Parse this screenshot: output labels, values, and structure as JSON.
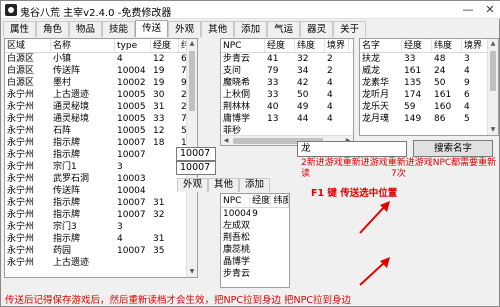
{
  "window": {
    "title": "鬼谷八荒 主宰v2.4.0 -免费修改器",
    "minimize": "—",
    "close": "✕"
  },
  "tabs": [
    "属性",
    "角色",
    "物品",
    "技能",
    "传送",
    "外观",
    "其他",
    "添加",
    "气运",
    "器灵",
    "关于"
  ],
  "active_tab": "传送",
  "left_list": {
    "columns": [
      "区域",
      "名称",
      "type",
      "经度",
      "纬度"
    ],
    "rows": [
      [
        "白源区",
        "小镇",
        "4",
        "12",
        "6"
      ],
      [
        "白源区",
        "传送阵",
        "10004",
        "19",
        "7"
      ],
      [
        "白源区",
        "墨村",
        "10002",
        "19",
        "9"
      ],
      [
        "永宁州",
        "上古遗迹",
        "10005",
        "30",
        "24"
      ],
      [
        "永宁州",
        "通灵秘境",
        "10005",
        "31",
        "22"
      ],
      [
        "永宁州",
        "通灵秘境",
        "10005",
        "33",
        "72"
      ],
      [
        "永宁州",
        "石阵",
        "10005",
        "12",
        "50"
      ],
      [
        "永宁州",
        "指示牌",
        "10007",
        "18",
        "11"
      ],
      [
        "永宁州",
        "指示牌",
        "10007",
        "",
        ""
      ],
      [
        "永宁州",
        "宗门1",
        "3",
        "",
        ""
      ],
      [
        "永宁州",
        "武罗石洞",
        "10003",
        "",
        ""
      ],
      [
        "永宁州",
        "传送阵",
        "10004",
        "",
        ""
      ],
      [
        "永宁州",
        "指示牌",
        "10007",
        "31",
        ""
      ],
      [
        "永宁州",
        "指示牌",
        "10007",
        "32",
        ""
      ],
      [
        "永宁州",
        "宗门3",
        "3",
        "",
        ""
      ],
      [
        "永宁州",
        "指示牌",
        "4",
        "31",
        ""
      ],
      [
        "永宁州",
        "药园",
        "10007",
        "35",
        ""
      ],
      [
        "永宁州",
        "上古遗迹",
        "",
        "",
        ""
      ]
    ]
  },
  "value_box_a": "10007",
  "value_box_b": "10007",
  "npc_list": {
    "columns": [
      "NPC",
      "经度",
      "纬度",
      "境界"
    ],
    "rows": [
      [
        "步青云",
        "41",
        "32",
        "2"
      ],
      [
        "支问",
        "79",
        "34",
        "2"
      ],
      [
        "魔晓希",
        "33",
        "42",
        "4"
      ],
      [
        "上秋侗",
        "33",
        "50",
        "4"
      ],
      [
        "荆林林",
        "40",
        "49",
        "4"
      ],
      [
        "庸博学",
        "13",
        "44",
        "4"
      ],
      [
        "菲秒",
        "",
        "",
        ""
      ]
    ]
  },
  "hero_list": {
    "columns": [
      "名字",
      "经度",
      "纬度",
      "境界"
    ],
    "rows": [
      [
        "扶龙",
        "33",
        "48",
        "3"
      ],
      [
        "威龙",
        "161",
        "24",
        "4"
      ],
      [
        "龙素华",
        "135",
        "50",
        "9"
      ],
      [
        "龙听月",
        "174",
        "161",
        "6"
      ],
      [
        "龙乐天",
        "59",
        "160",
        "4"
      ],
      [
        "龙月魂",
        "149",
        "86",
        "5"
      ]
    ]
  },
  "search": {
    "value": "龙",
    "button": "搜索名字"
  },
  "notice_text": "2新进游戏重新进游戏重新进游戏NPC都需要重新读",
  "notice_text2": "7次",
  "f1_hint": "F1 键 传送选中位置",
  "mini_tabs": [
    "外观",
    "其他",
    "添加"
  ],
  "npc_list2": {
    "columns": [
      "NPC",
      "经度",
      "纬度"
    ],
    "rows": [
      [
        "10004",
        "9",
        ""
      ],
      [
        "左成双",
        "",
        ""
      ],
      [
        "荆吾松",
        "",
        ""
      ],
      [
        "康蕊桃",
        "",
        ""
      ],
      [
        "晶博学",
        "",
        ""
      ],
      [
        "步青云",
        "",
        ""
      ]
    ]
  },
  "status_text": "传送后记得保存游戏后，然后重新读档才会生效，把NPC拉到身边 把NPC拉到身边",
  "colors": {
    "notice_red": "#e00000",
    "status_red": "#e00000"
  }
}
